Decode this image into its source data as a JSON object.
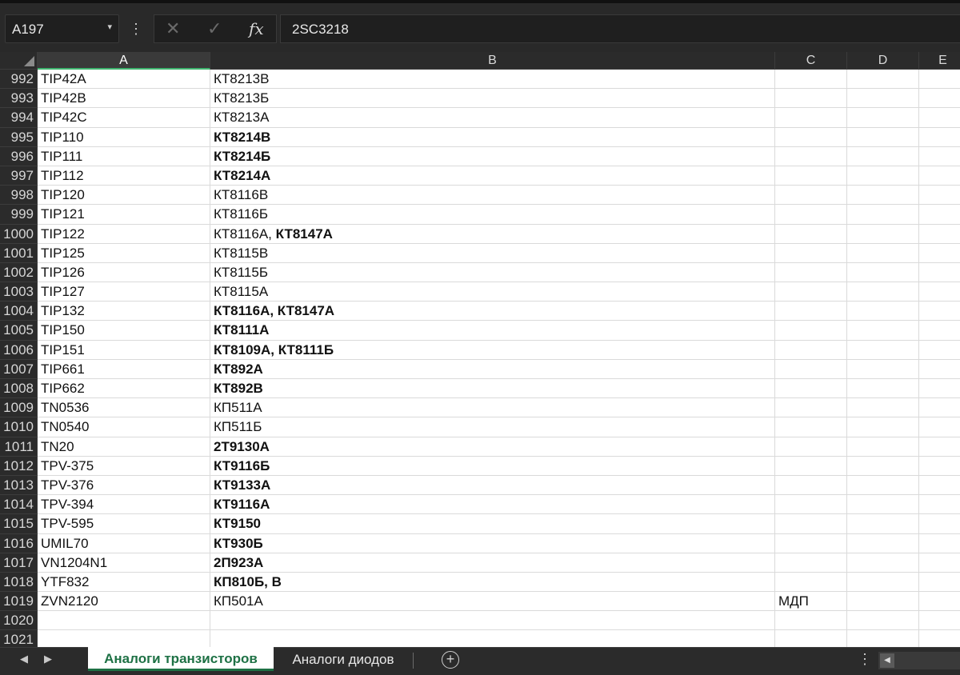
{
  "formula_bar": {
    "name_box": "A197",
    "name_box_arrow": "▾",
    "menu_glyph": "⋮",
    "cancel_glyph": "✕",
    "enter_glyph": "✓",
    "fx_label": "fx",
    "content": "2SC3218"
  },
  "columns": [
    "A",
    "B",
    "C",
    "D",
    "E"
  ],
  "selected_column": "A",
  "rows": [
    {
      "n": "992",
      "a": "TIP42A",
      "b": [
        {
          "t": "КТ8213В",
          "bold": false
        }
      ],
      "c": ""
    },
    {
      "n": "993",
      "a": "TIP42B",
      "b": [
        {
          "t": "КТ8213Б",
          "bold": false
        }
      ],
      "c": ""
    },
    {
      "n": "994",
      "a": "TIP42C",
      "b": [
        {
          "t": "КТ8213А",
          "bold": false
        }
      ],
      "c": ""
    },
    {
      "n": "995",
      "a": "TIP110",
      "b": [
        {
          "t": "КТ8214В",
          "bold": true
        }
      ],
      "c": ""
    },
    {
      "n": "996",
      "a": "TIP111",
      "b": [
        {
          "t": "КТ8214Б",
          "bold": true
        }
      ],
      "c": ""
    },
    {
      "n": "997",
      "a": "TIP112",
      "b": [
        {
          "t": "КТ8214А",
          "bold": true
        }
      ],
      "c": ""
    },
    {
      "n": "998",
      "a": "TIP120",
      "b": [
        {
          "t": "КТ8116В",
          "bold": false
        }
      ],
      "c": ""
    },
    {
      "n": "999",
      "a": "TIP121",
      "b": [
        {
          "t": "КТ8116Б",
          "bold": false
        }
      ],
      "c": ""
    },
    {
      "n": "1000",
      "a": "TIP122",
      "b": [
        {
          "t": "КТ8116А, ",
          "bold": false
        },
        {
          "t": "КТ8147А",
          "bold": true
        }
      ],
      "c": ""
    },
    {
      "n": "1001",
      "a": "TIP125",
      "b": [
        {
          "t": "КТ8115В",
          "bold": false
        }
      ],
      "c": ""
    },
    {
      "n": "1002",
      "a": "TIP126",
      "b": [
        {
          "t": "КТ8115Б",
          "bold": false
        }
      ],
      "c": ""
    },
    {
      "n": "1003",
      "a": "TIP127",
      "b": [
        {
          "t": "КТ8115А",
          "bold": false
        }
      ],
      "c": ""
    },
    {
      "n": "1004",
      "a": "TIP132",
      "b": [
        {
          "t": "КТ8116А, КТ8147А",
          "bold": true
        }
      ],
      "c": ""
    },
    {
      "n": "1005",
      "a": "TIP150",
      "b": [
        {
          "t": "КТ8111А",
          "bold": true
        }
      ],
      "c": ""
    },
    {
      "n": "1006",
      "a": "TIP151",
      "b": [
        {
          "t": "КТ8109А, КТ8111Б",
          "bold": true
        }
      ],
      "c": ""
    },
    {
      "n": "1007",
      "a": "TIP661",
      "b": [
        {
          "t": "КТ892А",
          "bold": true
        }
      ],
      "c": ""
    },
    {
      "n": "1008",
      "a": "TIP662",
      "b": [
        {
          "t": "КТ892В",
          "bold": true
        }
      ],
      "c": ""
    },
    {
      "n": "1009",
      "a": "TN0536",
      "b": [
        {
          "t": "КП511А",
          "bold": false
        }
      ],
      "c": ""
    },
    {
      "n": "1010",
      "a": "TN0540",
      "b": [
        {
          "t": "КП511Б",
          "bold": false
        }
      ],
      "c": ""
    },
    {
      "n": "1011",
      "a": "TN20",
      "b": [
        {
          "t": "2Т9130А",
          "bold": true
        }
      ],
      "c": ""
    },
    {
      "n": "1012",
      "a": "TPV-375",
      "b": [
        {
          "t": "КТ9116Б",
          "bold": true
        }
      ],
      "c": ""
    },
    {
      "n": "1013",
      "a": "TPV-376",
      "b": [
        {
          "t": "КТ9133А",
          "bold": true
        }
      ],
      "c": ""
    },
    {
      "n": "1014",
      "a": "TPV-394",
      "b": [
        {
          "t": "КТ9116А",
          "bold": true
        }
      ],
      "c": ""
    },
    {
      "n": "1015",
      "a": "TPV-595",
      "b": [
        {
          "t": "КТ9150",
          "bold": true
        }
      ],
      "c": ""
    },
    {
      "n": "1016",
      "a": "UMIL70",
      "b": [
        {
          "t": "КТ930Б",
          "bold": true
        }
      ],
      "c": ""
    },
    {
      "n": "1017",
      "a": "VN1204N1",
      "b": [
        {
          "t": "2П923А",
          "bold": true
        }
      ],
      "c": ""
    },
    {
      "n": "1018",
      "a": "YTF832",
      "b": [
        {
          "t": "КП810Б, В",
          "bold": true
        }
      ],
      "c": ""
    },
    {
      "n": "1019",
      "a": "ZVN2120",
      "b": [
        {
          "t": "КП501А",
          "bold": false
        }
      ],
      "c": "МДП"
    },
    {
      "n": "1020",
      "a": "",
      "b": [],
      "c": ""
    },
    {
      "n": "1021",
      "a": "",
      "b": [],
      "c": ""
    }
  ],
  "sheet_tabs": {
    "nav_prev": "◀",
    "nav_next": "▶",
    "active": "Аналоги транзисторов",
    "other": "Аналоги диодов",
    "add_glyph": "+",
    "menu_glyph": "⋮",
    "scroll_left_glyph": "◀"
  },
  "colors": {
    "accent_green": "#1e7145",
    "selection_green": "#3fb36f",
    "chrome_dark": "#2b2b2b"
  }
}
